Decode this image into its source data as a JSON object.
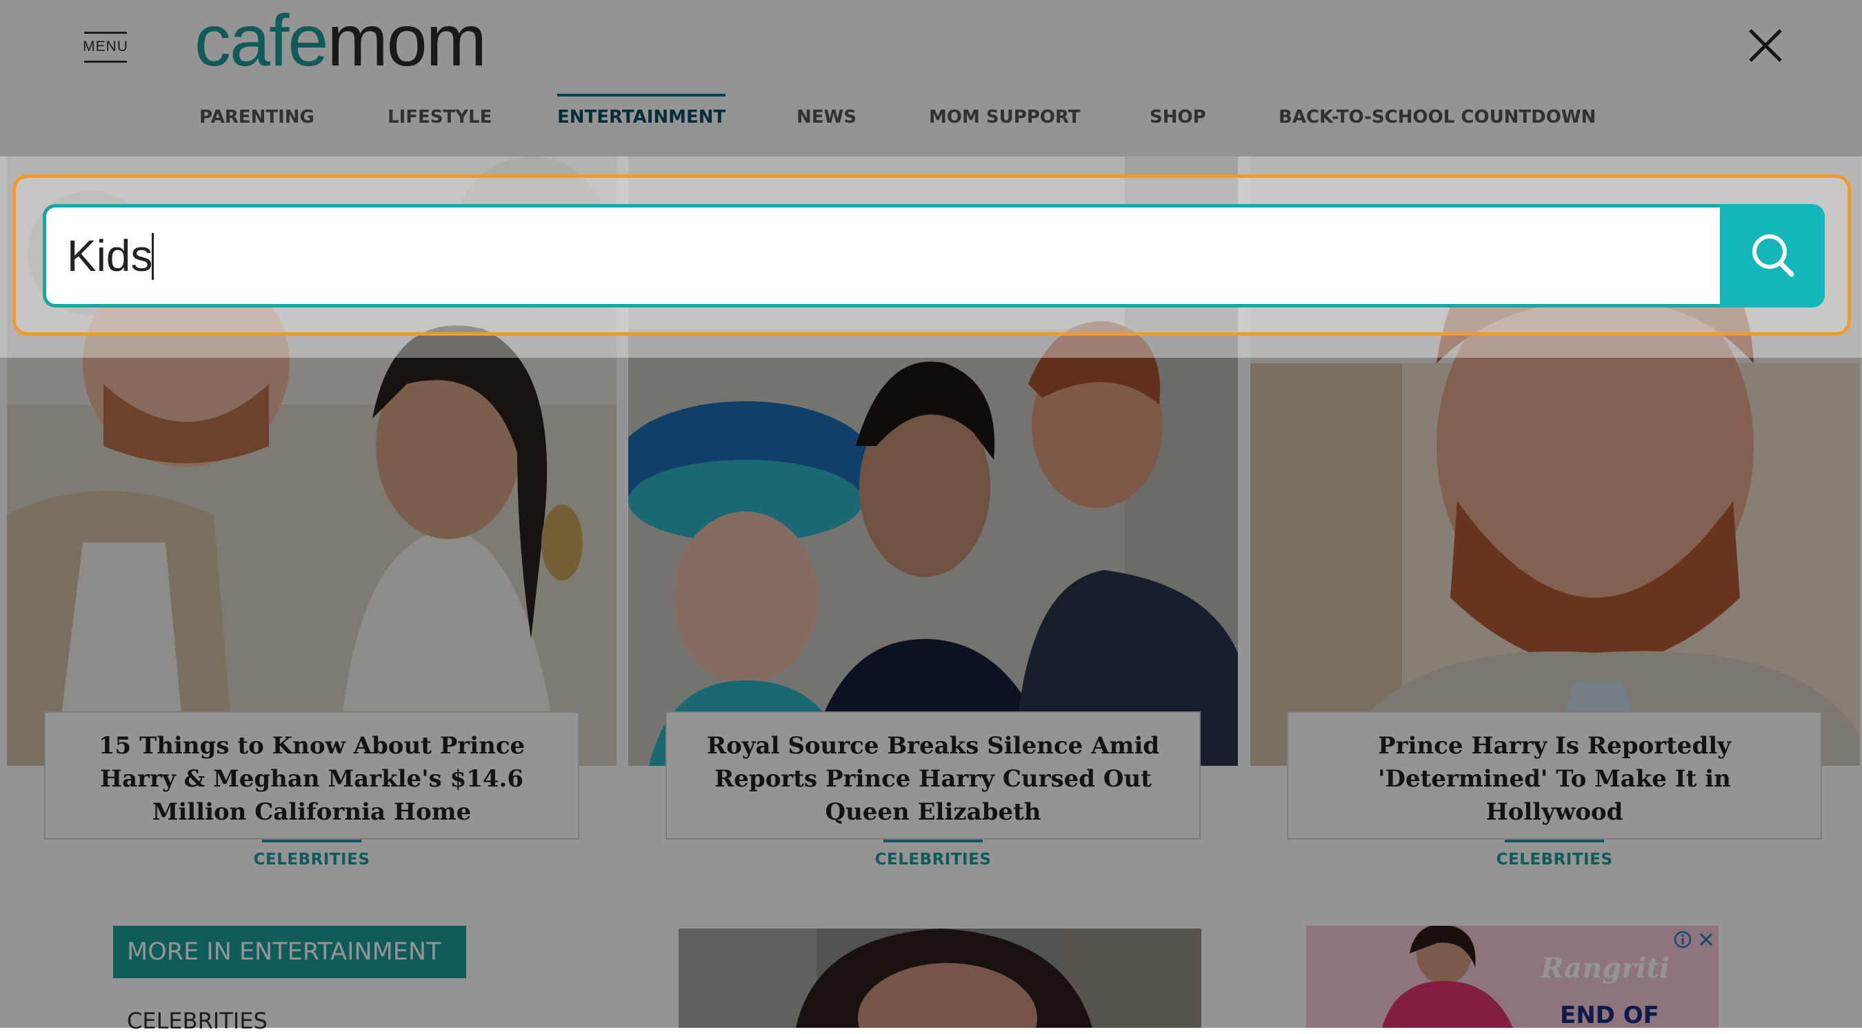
{
  "header": {
    "menu_label": "MENU",
    "logo_part1": "cafe",
    "logo_part2": "mom",
    "close_icon": "close-icon"
  },
  "nav": {
    "items": [
      {
        "label": "PARENTING"
      },
      {
        "label": "LIFESTYLE"
      },
      {
        "label": "ENTERTAINMENT",
        "active": true
      },
      {
        "label": "NEWS"
      },
      {
        "label": "MOM SUPPORT"
      },
      {
        "label": "SHOP"
      },
      {
        "label": "BACK-TO-SCHOOL COUNTDOWN"
      }
    ]
  },
  "search": {
    "value": "Kids",
    "icon": "search-icon"
  },
  "articles": [
    {
      "title": "15 Things to Know About Prince Harry & Meghan Markle's $14.6 Million California Home",
      "category": "CELEBRITIES"
    },
    {
      "title": "Royal Source Breaks Silence Amid Reports Prince Harry Cursed Out Queen Elizabeth",
      "category": "CELEBRITIES"
    },
    {
      "title": "Prince Harry Is Reportedly 'Determined' To Make It in Hollywood",
      "category": "CELEBRITIES"
    }
  ],
  "sidebar": {
    "more_label": "MORE IN ENTERTAINMENT",
    "first_link": "CELEBRITIES"
  },
  "ad": {
    "brand": "Rangriti",
    "promo": "END OF",
    "info_icon": "info-icon",
    "close_icon": "close-icon"
  },
  "colors": {
    "accent": "#1a9d9a",
    "focus_ring": "#f39a2c",
    "search_button": "#12b6bb",
    "overlay": "rgba(0,0,0,0.42)"
  }
}
